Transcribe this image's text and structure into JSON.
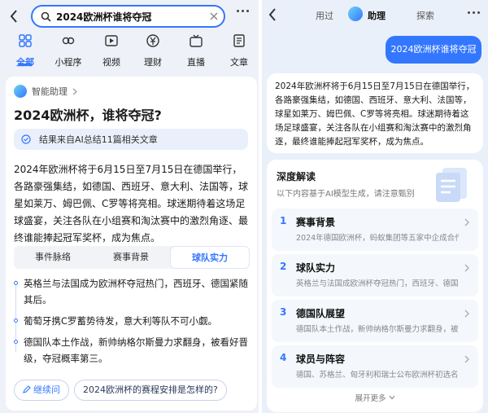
{
  "search": {
    "query": "2024欧洲杯谁将夺冠"
  },
  "tabs": [
    {
      "label": "全部"
    },
    {
      "label": "小程序"
    },
    {
      "label": "视频"
    },
    {
      "label": "理财"
    },
    {
      "label": "直播"
    },
    {
      "label": "文章"
    }
  ],
  "card": {
    "assistant_label": "智能助理",
    "title": "2024欧洲杯，谁将夺冠?",
    "source_note": "结果来自AI总结11篇相关文章",
    "body": "2024年欧洲杯将于6月15日至7月15日在德国举行，各路豪强集结，如德国、西班牙、意大利、法国等，球星如莱万、姆巴佩、C罗等将亮相。球迷期待着这场足球盛宴，关注各队在小组赛和淘汰赛中的激烈角逐、最终谁能捧起冠军奖杯，成为焦点。",
    "segments": [
      "事件脉络",
      "赛事背景",
      "球队实力"
    ],
    "timeline": [
      "英格兰与法国成为欧洲杯夺冠热门，西班牙、德国紧随其后。",
      "葡萄牙携C罗蓄势待发，意大利等队不可小觑。",
      "德国队本土作战，新帅纳格尔斯曼力求翻身，被看好晋级，夺冠概率第三。"
    ],
    "chips": [
      "继续问",
      "2024欧洲杯的赛程安排是怎样的?"
    ]
  },
  "right": {
    "top_tabs": [
      "用过",
      "助理",
      "探索"
    ],
    "user_message": "2024欧洲杯谁将夺冠",
    "answer": "2024年欧洲杯将于6月15日至7月15日在德国举行，各路豪强集结，如德国、西班牙、意大利、法国等，球星如莱万、姆巴佩、C罗等将亮相。球迷期待着这场足球盛宴，关注各队在小组赛和淘汰赛中的激烈角逐，最终谁能捧起冠军奖杯，成为焦点。",
    "deep_title": "深度解读",
    "deep_sub": "以下内容基于AI模型生成，请注意甄别",
    "items": [
      {
        "num": "1",
        "title": "赛事背景",
        "desc": "2024年德国欧洲杯，蚂蚁集团等五家中企成合作…"
      },
      {
        "num": "2",
        "title": "球队实力",
        "desc": "英格兰与法国成欧洲杯夺冠热门，西班牙、德国…"
      },
      {
        "num": "3",
        "title": "德国队展望",
        "desc": "德国队本土作战，新帅纳格尔斯曼力求翻身，被…"
      },
      {
        "num": "4",
        "title": "球员与阵容",
        "desc": "德国、苏格兰、匈牙利和瑞士公布欧洲杯初选名…"
      }
    ],
    "more_label": "展开更多"
  },
  "colors": {
    "accent": "#3377ff",
    "panel_bg": "#eef1f7"
  },
  "icons": [
    "back-arrow-icon",
    "search-icon",
    "clear-icon",
    "more-dots-icon",
    "grid-icon",
    "mini-program-icon",
    "video-icon",
    "finance-icon",
    "live-icon",
    "article-icon",
    "chevron-right-icon",
    "pencil-icon"
  ]
}
